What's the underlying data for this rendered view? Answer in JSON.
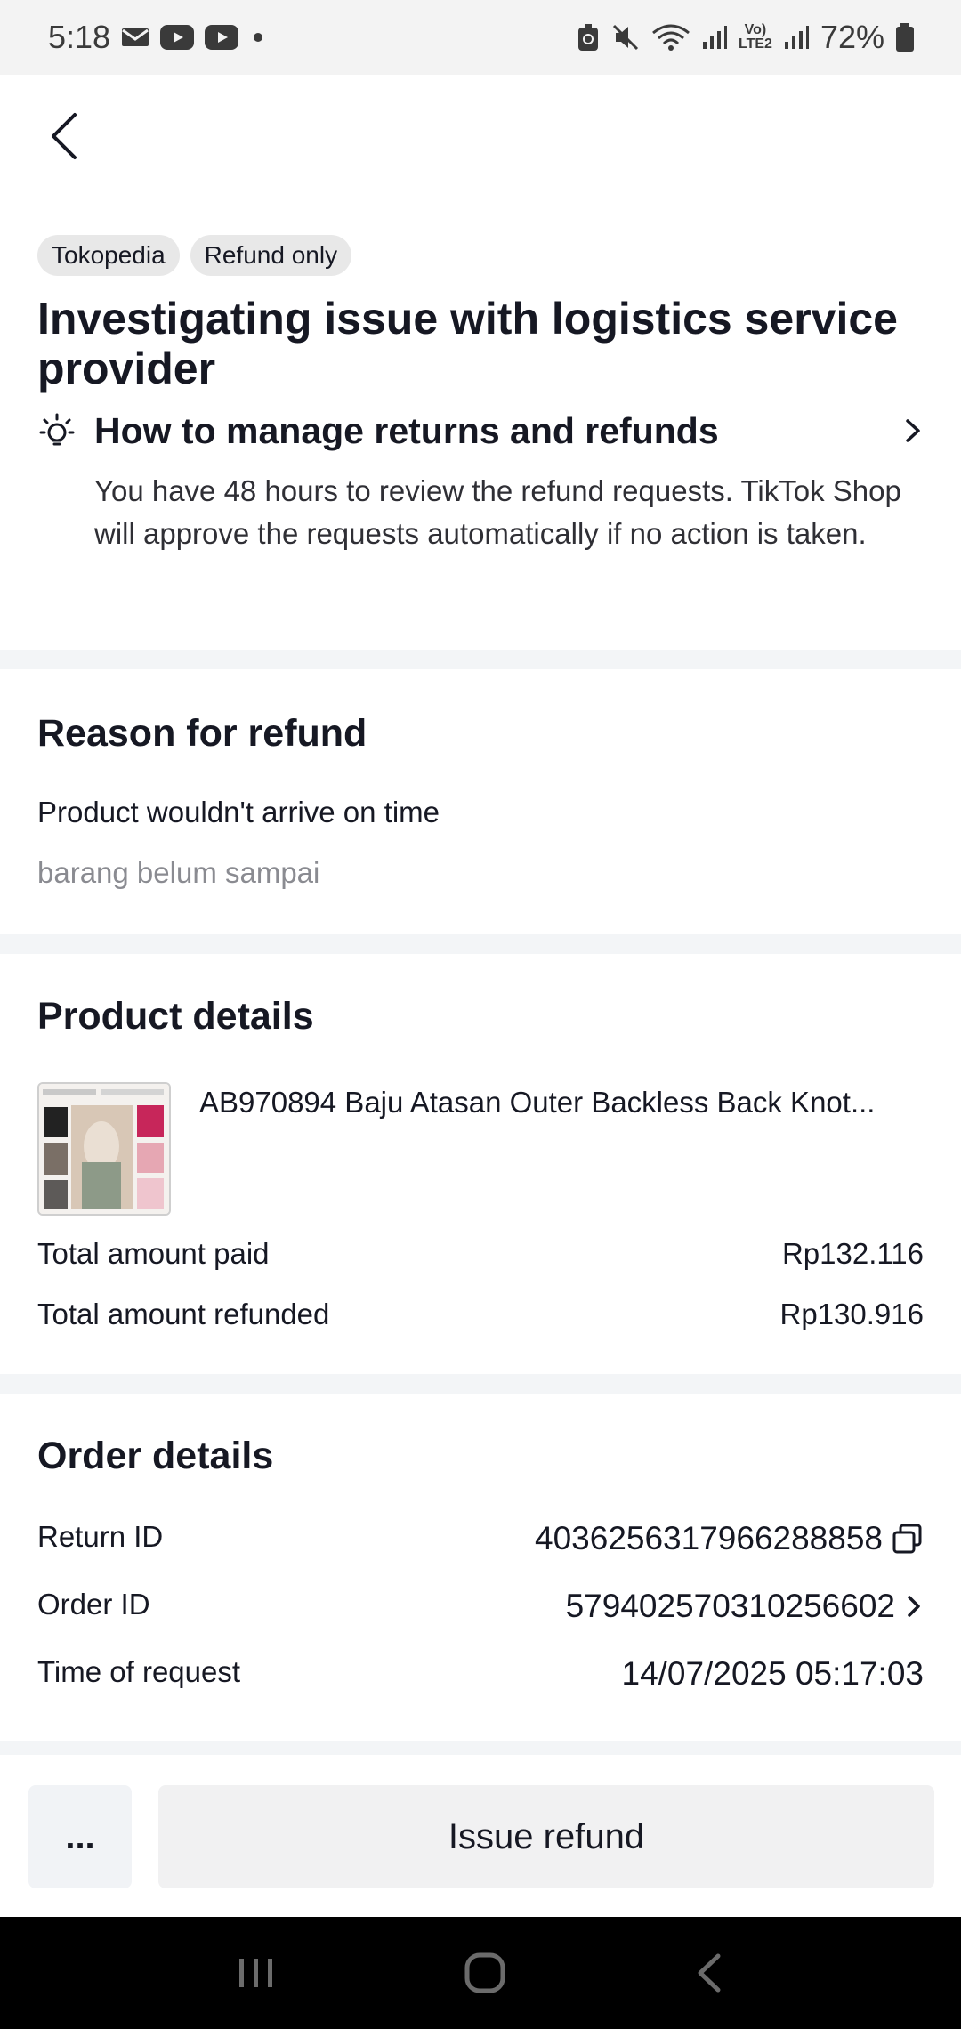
{
  "status_bar": {
    "time": "5:18",
    "battery": "72%",
    "icons": [
      "mail-icon",
      "youtube-icon",
      "youtube-icon",
      "dot-icon",
      "battery-saver-icon",
      "mute-icon",
      "wifi-icon",
      "signal-icon",
      "volte-icon",
      "signal-icon",
      "battery-icon"
    ],
    "volte_line1": "Vo)",
    "volte_line2": "LTE2"
  },
  "header": {
    "back_icon": "chevron-left-icon"
  },
  "status_card": {
    "tags": [
      "Tokopedia",
      "Refund only"
    ],
    "title": "Investigating issue with logistics service provider",
    "guide_title": "How to manage returns and refunds",
    "guide_text": "You have 48 hours to review the refund requests. TikTok Shop will approve the requests automatically if no action is taken."
  },
  "reason": {
    "title": "Reason for refund",
    "main": "Product wouldn't arrive on time",
    "note": "barang belum sampai"
  },
  "product": {
    "title": "Product details",
    "name": "AB970894 Baju Atasan Outer Backless Back Knot...",
    "paid_label": "Total amount paid",
    "paid_value": "Rp132.116",
    "refunded_label": "Total amount refunded",
    "refunded_value": "Rp130.916"
  },
  "order": {
    "title": "Order details",
    "return_id_label": "Return ID",
    "return_id_value": "4036256317966288858",
    "order_id_label": "Order ID",
    "order_id_value": "579402570310256602",
    "time_label": "Time of request",
    "time_value": "14/07/2025 05:17:03"
  },
  "actions": {
    "more_label": "...",
    "issue_label": "Issue refund"
  },
  "colors": {
    "background": "#f3f5f7",
    "card": "#ffffff",
    "text": "#161823",
    "muted": "#8a8b91",
    "tag": "#e8e8e8"
  }
}
